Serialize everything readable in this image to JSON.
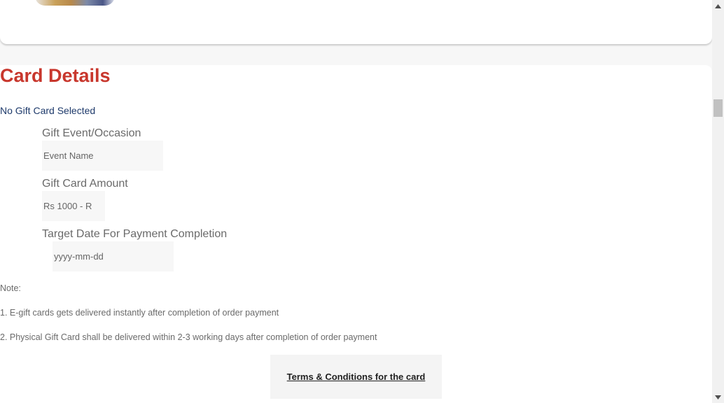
{
  "card_details": {
    "title": "Card Details",
    "selection_status": "No Gift Card Selected",
    "fields": {
      "occasion": {
        "label": "Gift Event/Occasion",
        "placeholder": "Event Name"
      },
      "amount": {
        "label": "Gift Card Amount",
        "placeholder": "Rs 1000 - R"
      },
      "target_date": {
        "label": "Target Date For Payment Completion",
        "placeholder": "yyyy-mm-dd"
      }
    },
    "notes": {
      "heading": "Note:",
      "items": [
        "1. E-gift cards gets delivered instantly after completion of order payment",
        "2. Physical Gift Card shall be delivered within 2-3 working days after completion of order payment"
      ]
    },
    "terms_link": "Terms & Conditions for the card"
  },
  "colors": {
    "title": "#c8372d",
    "status": "#1e3a6b",
    "label": "#6a6a6a",
    "input_bg": "#f7f7f7"
  },
  "icons": {
    "scroll_up": "chevron-up-icon",
    "scroll_down": "chevron-down-icon"
  }
}
